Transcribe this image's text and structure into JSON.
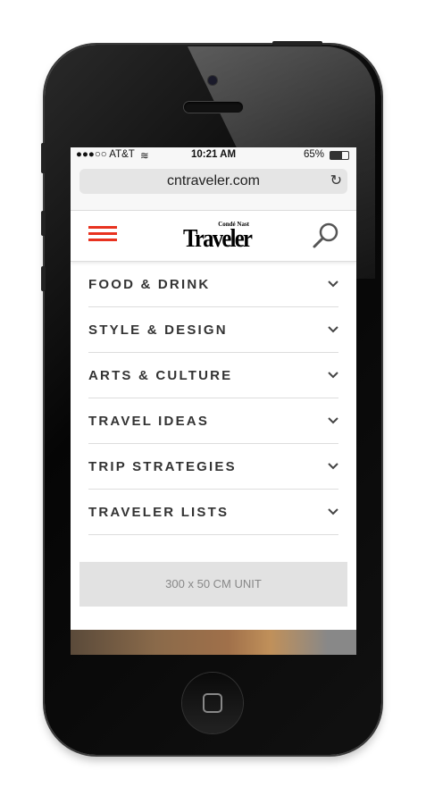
{
  "status": {
    "carrier": "●●●○○ AT&T",
    "time": "10:21 AM",
    "battery": "65%"
  },
  "browser": {
    "url": "cntraveler.com"
  },
  "header": {
    "logo_small": "Condé Nast",
    "logo_big": "Traveler",
    "accent": "#e8321f"
  },
  "menu": {
    "items": [
      {
        "label": "FOOD & DRINK"
      },
      {
        "label": "STYLE & DESIGN"
      },
      {
        "label": "ARTS & CULTURE"
      },
      {
        "label": "TRAVEL IDEAS"
      },
      {
        "label": "TRIP STRATEGIES"
      },
      {
        "label": "TRAVELER LISTS"
      }
    ]
  },
  "ad": {
    "label": "300 x 50 CM UNIT"
  }
}
